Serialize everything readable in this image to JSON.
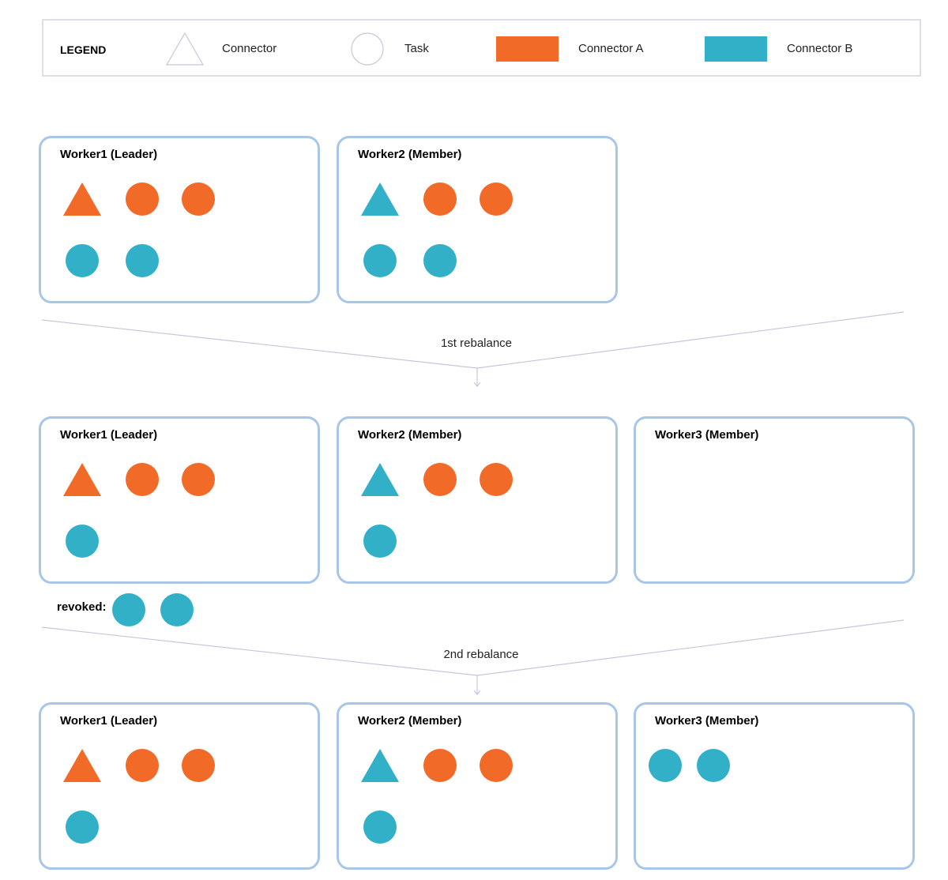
{
  "colors": {
    "connector_a": "#f26a27",
    "connector_b": "#31b0c8",
    "border": "#a8c6e8",
    "line": "#c5c8dc"
  },
  "legend": {
    "title": "LEGEND",
    "items": [
      {
        "symbol": "triangle-outline",
        "label": "Connector"
      },
      {
        "symbol": "circle-outline",
        "label": "Task"
      },
      {
        "symbol": "swatch-orange",
        "label": "Connector A"
      },
      {
        "symbol": "swatch-teal",
        "label": "Connector B"
      }
    ]
  },
  "stages": [
    {
      "workers": [
        {
          "title": "Worker1 (Leader)",
          "rows": [
            [
              "conn-A",
              "task-A",
              "task-A"
            ],
            [
              "task-B",
              "task-B"
            ]
          ]
        },
        {
          "title": "Worker2 (Member)",
          "rows": [
            [
              "conn-B",
              "task-A",
              "task-A"
            ],
            [
              "task-B",
              "task-B"
            ]
          ]
        }
      ]
    },
    {
      "workers": [
        {
          "title": "Worker1 (Leader)",
          "rows": [
            [
              "conn-A",
              "task-A",
              "task-A"
            ],
            [
              "task-B"
            ]
          ]
        },
        {
          "title": "Worker2 (Member)",
          "rows": [
            [
              "conn-B",
              "task-A",
              "task-A"
            ],
            [
              "task-B"
            ]
          ]
        },
        {
          "title": "Worker3 (Member)",
          "rows": []
        }
      ],
      "revoked": {
        "label": "revoked:",
        "items": [
          "task-B",
          "task-B"
        ]
      }
    },
    {
      "workers": [
        {
          "title": "Worker1 (Leader)",
          "rows": [
            [
              "conn-A",
              "task-A",
              "task-A"
            ],
            [
              "task-B"
            ]
          ]
        },
        {
          "title": "Worker2 (Member)",
          "rows": [
            [
              "conn-B",
              "task-A",
              "task-A"
            ],
            [
              "task-B"
            ]
          ]
        },
        {
          "title": "Worker3 (Member)",
          "rows": [
            [
              "task-B",
              "task-B"
            ]
          ]
        }
      ]
    }
  ],
  "transitions": [
    {
      "label": "1st rebalance"
    },
    {
      "label": "2nd rebalance"
    }
  ]
}
